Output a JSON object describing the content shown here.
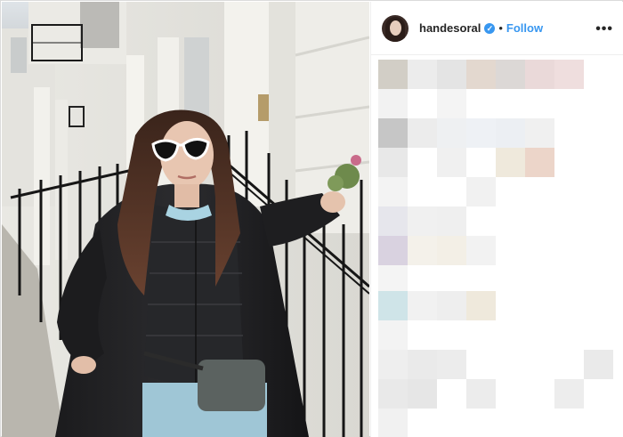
{
  "post": {
    "username": "handesoral",
    "verified_symbol": "✓",
    "separator": "•",
    "follow_label": "Follow",
    "more_label": "•••"
  },
  "photo": {
    "subject": "woman-in-black-coat-sunglasses-by-railing"
  },
  "colors": {
    "follow": "#3897f0",
    "text": "#262626",
    "border": "#efefef"
  }
}
